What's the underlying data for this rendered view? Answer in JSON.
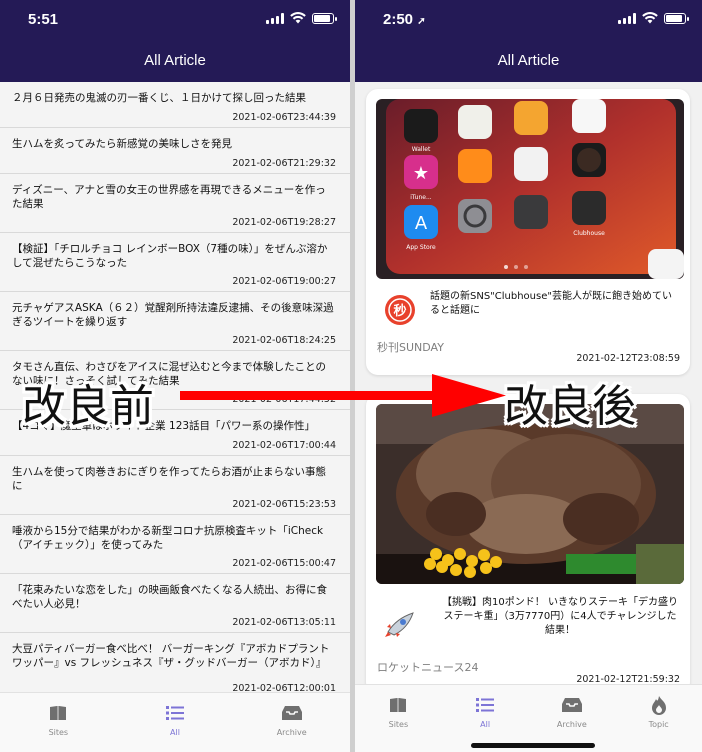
{
  "left_screen": {
    "status": {
      "time": "5:51"
    },
    "header": {
      "title": "All Article"
    },
    "articles": [
      {
        "title": "２月６日発売の鬼滅の刃一番くじ、１日かけて探し回った結果",
        "date": "2021-02-06T23:44:39"
      },
      {
        "title": "生ハムを炙ってみたら新感覚の美味しさを発見",
        "date": "2021-02-06T21:29:32"
      },
      {
        "title": "ディズニー、アナと雪の女王の世界感を再現できるメニューを作った結果",
        "date": "2021-02-06T19:28:27"
      },
      {
        "title": "【検証】「チロルチョコ レインボーBOX（7種の味）」をぜんぶ溶かして混ぜたらこうなった",
        "date": "2021-02-06T19:00:27"
      },
      {
        "title": "元チャゲアスASKA（６２）覚醒剤所持法違反逮捕、その後意味深過ぎるツイートを繰り返す",
        "date": "2021-02-06T18:24:25"
      },
      {
        "title": "タモさん直伝、わさびをアイスに混ぜ込むと今まで体験したことのない味に！さっそく試してみた結果",
        "date": "2021-02-06T17:44:52"
      },
      {
        "title": "【4コマ】魔王軍はホワイト企業 123話目「パワー系の操作性」",
        "date": "2021-02-06T17:00:44"
      },
      {
        "title": "生ハムを使って肉巻きおにぎりを作ってたらお酒が止まらない事態に",
        "date": "2021-02-06T15:23:53"
      },
      {
        "title": "唾液から15分で結果がわかる新型コロナ抗原検査キット「iCheck（アイチェック）」を使ってみた",
        "date": "2021-02-06T15:00:47"
      },
      {
        "title": "「花束みたいな恋をした」の映画飯食べたくなる人続出、お得に食べたい人必見！",
        "date": "2021-02-06T13:05:11"
      },
      {
        "title": "大豆パティバーガー食べ比べ！ バーガーキング『アボカドプラントワッパー』vs フレッシュネス『ザ・グッドバーガー（アボカド）』",
        "date": "2021-02-06T12:00:01"
      }
    ],
    "tabs": [
      {
        "label": "Sites",
        "icon": "book-icon"
      },
      {
        "label": "All",
        "icon": "list-icon"
      },
      {
        "label": "Archive",
        "icon": "archive-icon"
      }
    ],
    "active_tab": "All"
  },
  "right_screen": {
    "status": {
      "time": "2:50"
    },
    "header": {
      "title": "All Article"
    },
    "cards": [
      {
        "title": "話題の新SNS\"Clubhouse\"芸能人が既に飽き始めていると話題に",
        "source": "秒刊SUNDAY",
        "date": "2021-02-12T23:08:59",
        "logo_text": "秒",
        "image": "iphone-home-screen-photo"
      },
      {
        "title": "【挑戦】肉10ポンド！ いきなりステーキ「デカ盛りステーキ重」（3万7770円）に4人でチャレンジした結果！",
        "source": "ロケットニュース24",
        "date": "2021-02-12T21:59:32",
        "logo_text": "",
        "image": "steak-photo"
      }
    ],
    "tabs": [
      {
        "label": "Sites",
        "icon": "book-icon"
      },
      {
        "label": "All",
        "icon": "list-icon"
      },
      {
        "label": "Archive",
        "icon": "archive-icon"
      },
      {
        "label": "Topic",
        "icon": "flame-icon"
      }
    ],
    "active_tab": "All"
  },
  "annotation": {
    "before_label": "改良前",
    "after_label": "改良後",
    "arrow_color": "#ff0000"
  },
  "colors": {
    "header_bg": "#241a56",
    "accent": "#7d74d6",
    "text": "#111111",
    "muted": "#8a8a8a"
  }
}
